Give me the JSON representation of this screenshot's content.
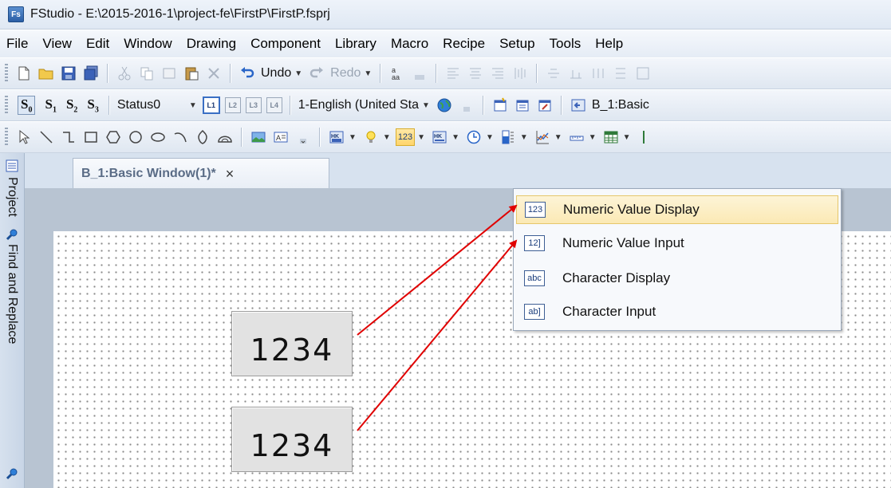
{
  "window": {
    "app_icon": "Fs",
    "title": "FStudio - E:\\2015-2016-1\\project-fe\\FirstP\\FirstP.fsprj"
  },
  "menu": [
    "File",
    "View",
    "Edit",
    "Window",
    "Drawing",
    "Component",
    "Library",
    "Macro",
    "Recipe",
    "Setup",
    "Tools",
    "Help"
  ],
  "toolbar1": {
    "undo_label": "Undo",
    "redo_label": "Redo",
    "case_label": "a/aa"
  },
  "toolbar2": {
    "states": [
      {
        "letter": "S",
        "sub": "0"
      },
      {
        "letter": "S",
        "sub": "1"
      },
      {
        "letter": "S",
        "sub": "2"
      },
      {
        "letter": "S",
        "sub": "3"
      }
    ],
    "status_value": "Status0",
    "layers": [
      "L1",
      "L2",
      "L3",
      "L4"
    ],
    "language_value": "1-English (United Sta",
    "window_value": "B_1:Basic"
  },
  "toolbar3": {
    "numeric_button": "123",
    "hk_label": "HK"
  },
  "left_dock": {
    "project_label": "Project",
    "find_label": "Find and Replace"
  },
  "document_tab": {
    "label": "B_1:Basic Window(1)*",
    "close": "×"
  },
  "dropdown": {
    "items": [
      {
        "icon": "123",
        "label": "Numeric Value Display",
        "highlighted": true
      },
      {
        "icon": "12]",
        "label": "Numeric Value Input",
        "highlighted": false
      },
      {
        "icon": "abc",
        "label": "Character Display",
        "highlighted": false
      },
      {
        "icon": "ab]",
        "label": "Character Input",
        "highlighted": false
      }
    ]
  },
  "canvas_objects": [
    {
      "value": "1234"
    },
    {
      "value": "1234"
    }
  ],
  "colors": {
    "accent": "#3a6fc4",
    "highlight": "#fbe9b4",
    "arrow": "#e00000"
  }
}
